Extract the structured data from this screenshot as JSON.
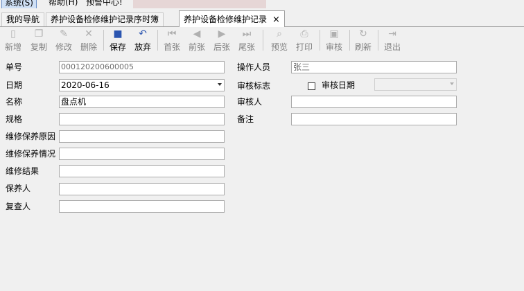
{
  "menu": {
    "system": "系统(S)",
    "help": "帮助(H)",
    "alert_center": "预警中心!"
  },
  "tabs": [
    {
      "label": "我的导航"
    },
    {
      "label": "养护设备检修维护记录序时簿"
    },
    {
      "label": "养护设备检修维护记录",
      "close": "×"
    }
  ],
  "toolbar": {
    "new": "新增",
    "copy": "复制",
    "edit": "修改",
    "delete": "删除",
    "save": "保存",
    "discard": "放弃",
    "first": "首张",
    "prev": "前张",
    "next": "后张",
    "last": "尾张",
    "preview": "预览",
    "print": "打印",
    "audit": "审核",
    "refresh": "刷新",
    "exit": "退出"
  },
  "form": {
    "labels": {
      "doc_no": "单号",
      "date": "日期",
      "name": "名称",
      "spec": "规格",
      "repair_reason": "维修保养原因",
      "repair_status": "维修保养情况",
      "repair_result": "维修结果",
      "maintainer": "保养人",
      "reviewer": "复查人",
      "operator": "操作人员",
      "audit_flag": "审核标志",
      "audit_date": "审核日期",
      "auditor": "审核人",
      "remark": "备注"
    },
    "values": {
      "doc_no": "000120200600005",
      "date": "2020-06-16",
      "name": "盘点机",
      "spec": "",
      "repair_reason": "",
      "repair_status": "",
      "repair_result": "",
      "maintainer": "",
      "reviewer": "",
      "operator": "张三",
      "audit_date": "",
      "auditor": "",
      "remark": ""
    },
    "audit_checked": false
  }
}
